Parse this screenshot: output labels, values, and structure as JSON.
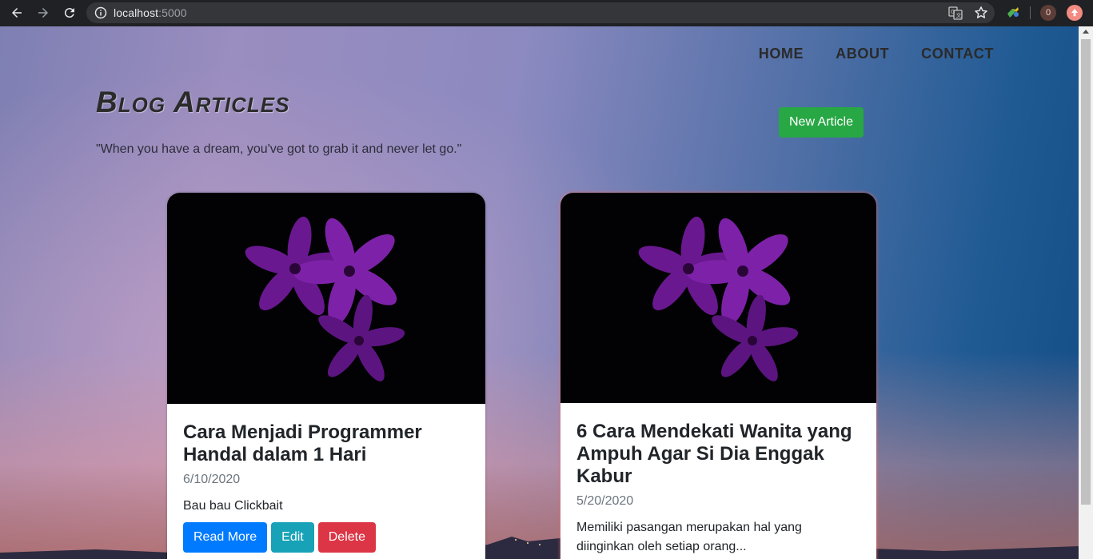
{
  "browser": {
    "url_host": "localhost",
    "url_port": ":5000",
    "extension_badge": "0"
  },
  "nav": {
    "items": [
      {
        "label": "HOME"
      },
      {
        "label": "ABOUT"
      },
      {
        "label": "CONTACT"
      }
    ]
  },
  "page": {
    "title": "Blog Articles",
    "quote": "\"When you have a dream, you've got to grab it and never let go.\"",
    "new_article_label": "New Article"
  },
  "articles": [
    {
      "title": "Cara Menjadi Programmer Handal dalam 1 Hari",
      "date": "6/10/2020",
      "excerpt": "Bau bau Clickbait",
      "read_more_label": "Read More",
      "edit_label": "Edit",
      "delete_label": "Delete"
    },
    {
      "title": "6 Cara Mendekati Wanita yang Ampuh Agar Si Dia Enggak Kabur",
      "date": "5/20/2020",
      "excerpt": "Memiliki pasangan merupakan hal yang diinginkan oleh setiap orang..."
    }
  ],
  "colors": {
    "new_article": "#28a745",
    "read_more": "#007bff",
    "edit": "#17a2b8",
    "delete": "#dc3545",
    "flower": "#7a1fa2"
  },
  "icons": [
    "back-arrow-icon",
    "forward-arrow-icon",
    "reload-icon",
    "info-icon",
    "translate-icon",
    "star-icon",
    "extension-icon",
    "profile-icon",
    "update-icon"
  ]
}
